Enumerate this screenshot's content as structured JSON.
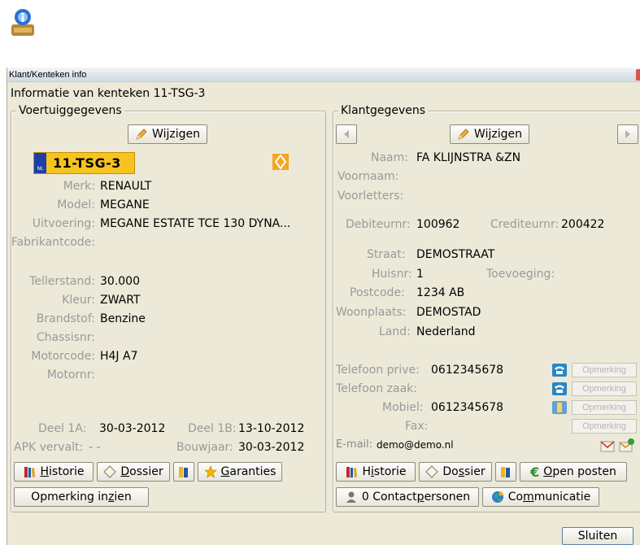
{
  "window": {
    "title": "Klant/Kenteken info"
  },
  "header": "Informatie van kenteken 11-TSG-3",
  "vehicle": {
    "group_title": "Voertuiggegevens",
    "edit_label": "Wijzigen",
    "plate": "11-TSG-3",
    "plate_country": "NL",
    "fields": [
      {
        "label": "Merk:",
        "value": "RENAULT"
      },
      {
        "label": "Model:",
        "value": "MEGANE"
      },
      {
        "label": "Uitvoering:",
        "value": "MEGANE ESTATE TCE 130 DYNA..."
      },
      {
        "label": "Fabrikantcode:",
        "value": ""
      },
      {
        "label": "Tellerstand:",
        "value": "30.000"
      },
      {
        "label": "Kleur:",
        "value": "ZWART"
      },
      {
        "label": "Brandstof:",
        "value": "Benzine"
      },
      {
        "label": "Chassisnr:",
        "value": ""
      },
      {
        "label": "Motorcode:",
        "value": "H4J A7"
      },
      {
        "label": "Motornr:",
        "value": ""
      }
    ],
    "deel1a_label": "Deel 1A:",
    "deel1a_value": "30-03-2012",
    "deel1b_label": "Deel 1B:",
    "deel1b_value": "13-10-2012",
    "apk_label": "APK vervalt:",
    "apk_value": "- -",
    "bouwjaar_label": "Bouwjaar:",
    "bouwjaar_value": "30-03-2012",
    "btn_historie": "Historie",
    "btn_dossier": "Dossier",
    "btn_garanties": "Garanties",
    "btn_opmerking": "Opmerking inzien"
  },
  "customer": {
    "group_title": "Klantgegevens",
    "edit_label": "Wijzigen",
    "naam_label": "Naam:",
    "naam_value": "FA KLIJNSTRA &ZN",
    "voornaam_label": "Voornaam:",
    "voorletters_label": "Voorletters:",
    "debiteur_label": "Debiteurnr:",
    "debiteur_value": "100962",
    "crediteur_label": "Crediteurnr:",
    "crediteur_value": "200422",
    "straat_label": "Straat:",
    "straat_value": "DEMOSTRAAT",
    "huisnr_label": "Huisnr:",
    "huisnr_value": "1",
    "toevoeging_label": "Toevoeging:",
    "postcode_label": "Postcode:",
    "postcode_value": "1234 AB",
    "woonplaats_label": "Woonplaats:",
    "woonplaats_value": "DEMOSTAD",
    "land_label": "Land:",
    "land_value": "Nederland",
    "tel_prive_label": "Telefoon prive:",
    "tel_prive_value": "0612345678",
    "tel_zaak_label": "Telefoon zaak:",
    "mobiel_label": "Mobiel:",
    "mobiel_value": "0612345678",
    "fax_label": "Fax:",
    "email_label": "E-mail:",
    "email_value": "demo@demo.nl",
    "opmerking_label": "Opmerking",
    "btn_historie": "Historie",
    "btn_dossier": "Dossier",
    "btn_open_posten": "Open posten",
    "btn_contact": "0 Contactpersonen",
    "btn_communicatie": "Communicatie"
  },
  "footer": {
    "close_label": "Sluiten"
  }
}
